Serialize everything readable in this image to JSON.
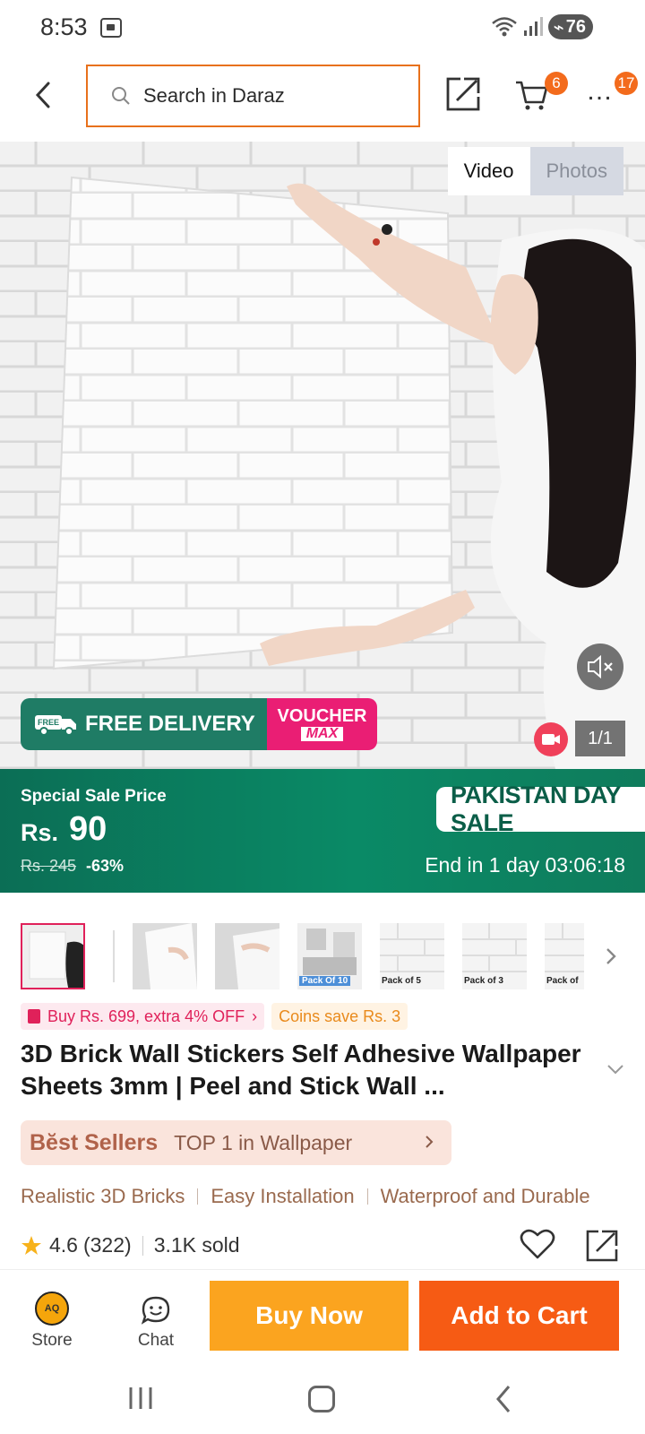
{
  "status": {
    "time": "8:53",
    "battery": "76"
  },
  "search": {
    "placeholder": "Search in Daraz"
  },
  "badges": {
    "cart": "6",
    "more": "17"
  },
  "media": {
    "tabs": [
      {
        "label": "Video",
        "active": true
      },
      {
        "label": "Photos",
        "active": false
      }
    ],
    "counter": "1/1"
  },
  "promo": {
    "free_tag": "FREE",
    "delivery": "FREE DELIVERY",
    "voucher": "VOUCHER",
    "voucher_sub": "MAX"
  },
  "sale": {
    "label": "Special Sale Price",
    "currency": "Rs.",
    "price": "90",
    "original": "Rs. 245",
    "discount": "-63%",
    "event": "PAKISTAN DAY SALE",
    "countdown": "End in 1 day 03:06:18"
  },
  "thumbnails": [
    {
      "caption": ""
    },
    {
      "caption": ""
    },
    {
      "caption": ""
    },
    {
      "caption": "Pack Of 10"
    },
    {
      "caption": "Pack of 5"
    },
    {
      "caption": "Pack of 3"
    },
    {
      "caption": "Pack of"
    }
  ],
  "chips": {
    "promo": "Buy Rs. 699, extra 4% OFF",
    "coins": "Coins save Rs. 3"
  },
  "product": {
    "title": "3D Brick Wall Stickers Self Adhesive Wallpaper Sheets 3mm | Peel and Stick Wall ..."
  },
  "best_sellers": {
    "label": "Bĕst Sellers",
    "rank": "TOP 1 in Wallpaper"
  },
  "features": [
    "Realistic 3D Bricks",
    "Easy Installation",
    "Waterproof and Durable"
  ],
  "rating": {
    "value": "4.6",
    "reviews": "(322)",
    "sold": "3.1K sold"
  },
  "actions": {
    "store_label": "Store",
    "store_logo": "AQ",
    "chat_label": "Chat",
    "buy_now": "Buy Now",
    "add_to_cart": "Add to Cart"
  },
  "colors": {
    "accent": "#f65b14",
    "sale_green": "#0a8a66",
    "buy_now": "#fba41f",
    "search_border": "#e8711c"
  }
}
